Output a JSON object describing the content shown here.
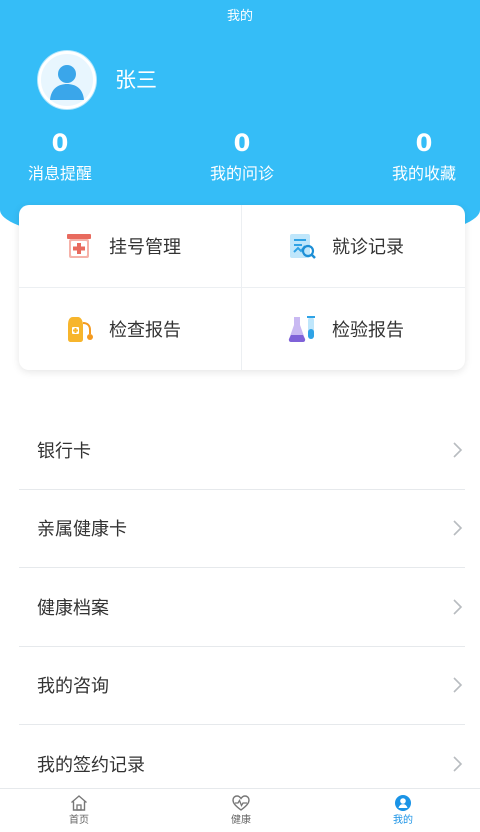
{
  "header": {
    "title": "我的"
  },
  "user": {
    "name": "张三"
  },
  "stats": [
    {
      "value": "0",
      "label": "消息提醒"
    },
    {
      "value": "0",
      "label": "我的问诊"
    },
    {
      "value": "0",
      "label": "我的收藏"
    }
  ],
  "quick_actions": [
    {
      "label": "挂号管理",
      "icon": "registration-icon"
    },
    {
      "label": "就诊记录",
      "icon": "visit-record-icon"
    },
    {
      "label": "检查报告",
      "icon": "exam-report-icon"
    },
    {
      "label": "检验报告",
      "icon": "lab-report-icon"
    }
  ],
  "menu": [
    {
      "label": "银行卡"
    },
    {
      "label": "亲属健康卡"
    },
    {
      "label": "健康档案"
    },
    {
      "label": "我的咨询"
    },
    {
      "label": "我的签约记录"
    }
  ],
  "tabbar": [
    {
      "label": "首页",
      "icon": "home-icon",
      "active": false
    },
    {
      "label": "健康",
      "icon": "health-icon",
      "active": false
    },
    {
      "label": "我的",
      "icon": "profile-icon",
      "active": true
    }
  ],
  "colors": {
    "primary": "#35bdf7",
    "active_tab": "#1a93e6"
  }
}
